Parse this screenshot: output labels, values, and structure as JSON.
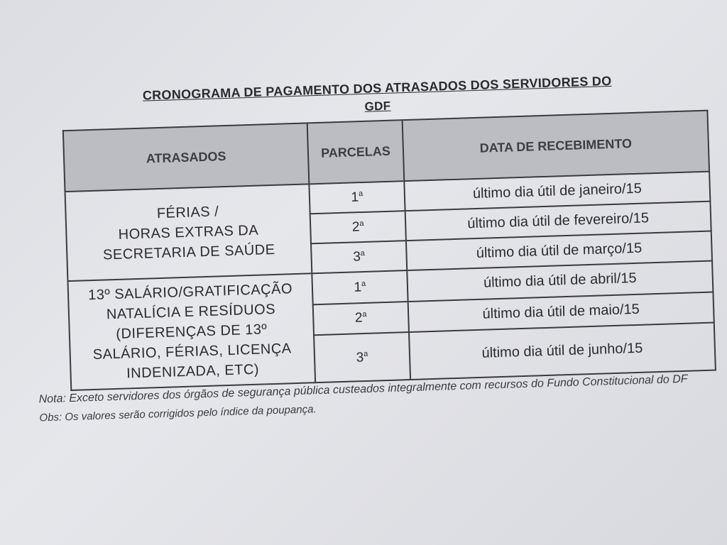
{
  "title_line1": "CRONOGRAMA DE PAGAMENTO DOS ATRASADOS DOS SERVIDORES DO",
  "title_line2": "GDF",
  "table": {
    "headers": [
      "ATRASADOS",
      "PARCELAS",
      "DATA DE RECEBIMENTO"
    ],
    "groups": [
      {
        "label_lines": [
          "FÉRIAS  /",
          "HORAS EXTRAS DA",
          "SECRETARIA DE SAÚDE"
        ],
        "rows": [
          {
            "parcela": "1",
            "sup": "a",
            "data": "último dia útil de janeiro/15"
          },
          {
            "parcela": "2",
            "sup": "a",
            "data": "último dia útil de fevereiro/15"
          },
          {
            "parcela": "3",
            "sup": "a",
            "data": "último dia útil de março/15"
          }
        ]
      },
      {
        "label_lines": [
          "13º SALÁRIO/GRATIFICAÇÃO",
          "NATALÍCIA E RESÍDUOS",
          "(DIFERENÇAS DE 13º",
          "SALÁRIO, FÉRIAS, LICENÇA",
          "INDENIZADA, ETC)"
        ],
        "rows": [
          {
            "parcela": "1",
            "sup": "a",
            "data": "último dia útil de abril/15"
          },
          {
            "parcela": "2",
            "sup": "a",
            "data": "último dia útil de maio/15"
          },
          {
            "parcela": "3",
            "sup": "a",
            "data": "último dia útil de junho/15"
          }
        ]
      }
    ]
  },
  "nota": "Nota: Exceto servidores dos órgãos de segurança pública custeados integralmente com recursos do Fundo Constitucional do DF",
  "obs": "Obs: Os valores serão corrigidos pelo índice da poupança."
}
